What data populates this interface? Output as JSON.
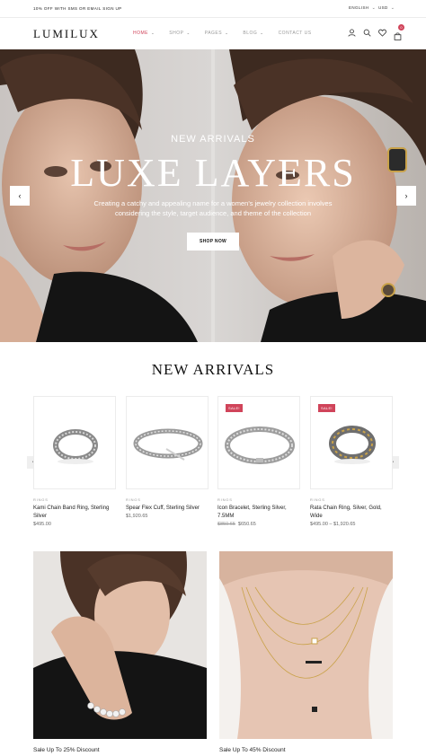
{
  "topbar": {
    "promo": "10% OFF WITH SMS OR EMAIL SIGN UP",
    "language": "ENGLISH",
    "currency": "USD"
  },
  "header": {
    "logo": "LUMILUX",
    "nav": [
      {
        "label": "HOME",
        "active": true
      },
      {
        "label": "SHOP",
        "active": false
      },
      {
        "label": "PAGES",
        "active": false
      },
      {
        "label": "BLOG",
        "active": false
      },
      {
        "label": "CONTACT US",
        "active": false
      }
    ],
    "icons": [
      "user-icon",
      "search-icon",
      "heart-icon",
      "bag-icon"
    ],
    "cart_count": "0"
  },
  "hero": {
    "subtitle": "NEW ARRIVALS",
    "title": "LUXE LAYERS",
    "description": "Creating a catchy and appealing name for a women's jewelry collection involves considering the style, target audience, and theme of the collection",
    "button": "SHOP NOW"
  },
  "new_arrivals": {
    "title": "NEW ARRIVALS",
    "products": [
      {
        "category": "RINGS",
        "name": "Kami Chain Band Ring, Sterling Silver",
        "price": "$495.00",
        "old_price": "",
        "sale": ""
      },
      {
        "category": "RINGS",
        "name": "Spear Flex Cuff, Sterling Silver",
        "price": "$1,920.65",
        "old_price": "",
        "sale": ""
      },
      {
        "category": "RINGS",
        "name": "Icon Bracelet, Sterling Silver, 7.5MM",
        "price": "$650.65",
        "old_price": "$850.65",
        "sale": "SALE!"
      },
      {
        "category": "RINGS",
        "name": "Rata Chain Ring, Silver, Gold, Wide",
        "price": "$495.00 – $1,920.65",
        "old_price": "",
        "sale": "SALE!"
      }
    ]
  },
  "banners": [
    {
      "caption": "Sale Up To 25% Discount"
    },
    {
      "caption": "Sale Up To 45% Discount"
    }
  ],
  "colors": {
    "accent": "#d0445a",
    "text": "#222222",
    "muted": "#999999"
  }
}
